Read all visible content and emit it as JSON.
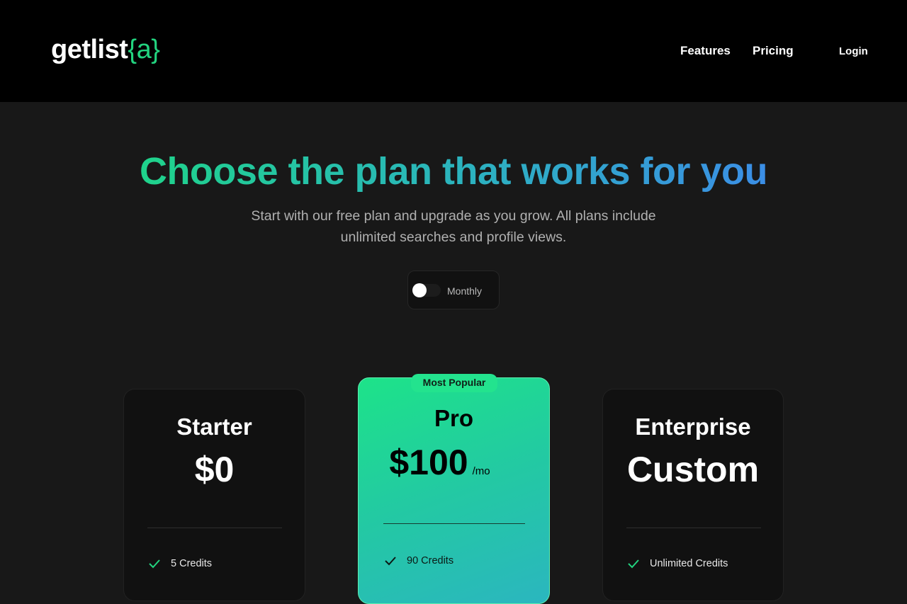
{
  "header": {
    "logo_main": "getlist",
    "logo_brace": "{a}",
    "nav": {
      "features": "Features",
      "pricing": "Pricing",
      "login": "Login"
    }
  },
  "hero": {
    "headline": "Choose the plan that works for you",
    "subtitle": "Start with our free plan and upgrade as you grow. All plans include unlimited searches and profile views."
  },
  "billing_toggle": {
    "label": "Monthly",
    "on": false
  },
  "plans": [
    {
      "name": "Starter",
      "price": "$0",
      "feature": "5 Credits"
    },
    {
      "name": "Pro",
      "price": "$100",
      "per": "/mo",
      "badge": "Most Popular",
      "feature": "90 Credits"
    },
    {
      "name": "Enterprise",
      "price": "Custom",
      "feature": "Unlimited Credits"
    }
  ],
  "colors": {
    "brand_green": "#22d37f",
    "gradient_start": "#1fd38b",
    "gradient_end": "#3b8ee6"
  }
}
